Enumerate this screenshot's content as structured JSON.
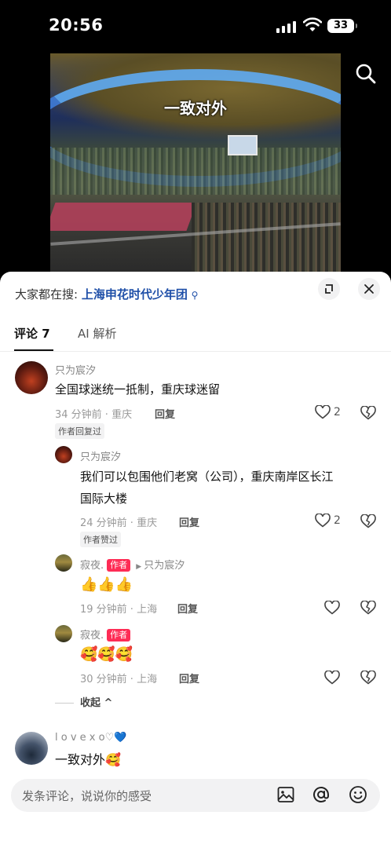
{
  "status_bar": {
    "time": "20:56",
    "battery": "33"
  },
  "video": {
    "caption": "一致对外"
  },
  "sheet": {
    "search_label": "大家都在搜:",
    "search_term": "上海申花时代少年团",
    "tabs": [
      {
        "label": "评论 7"
      },
      {
        "label": "AI 解析"
      }
    ]
  },
  "comments": [
    {
      "user": "只为宸汐",
      "text": "全国球迷统一抵制，重庆球迷留",
      "meta": "34 分钟前 · 重庆",
      "reply": "回复",
      "tag": "作者回复过",
      "likes": "2"
    },
    {
      "user": "只为宸汐",
      "text_line1": "我们可以包围他们老窝（公司），重庆南岸区长江",
      "text_line2": "国际大楼",
      "meta": "24 分钟前 · 重庆",
      "reply": "回复",
      "tag": "作者赞过",
      "likes": "2"
    },
    {
      "user": "寂夜.",
      "author_tag": "作者",
      "reply_to": "只为宸汐",
      "text": "👍👍👍",
      "meta": "19 分钟前 · 上海",
      "reply": "回复"
    },
    {
      "user": "寂夜.",
      "author_tag": "作者",
      "text": "🥰🥰🥰",
      "meta": "30 分钟前 · 上海",
      "reply": "回复"
    },
    {
      "user": "l o v e x o♡💙",
      "text": "一致对外🥰"
    }
  ],
  "collapse_label": "收起",
  "input": {
    "placeholder": "发条评论，说说你的感受"
  }
}
